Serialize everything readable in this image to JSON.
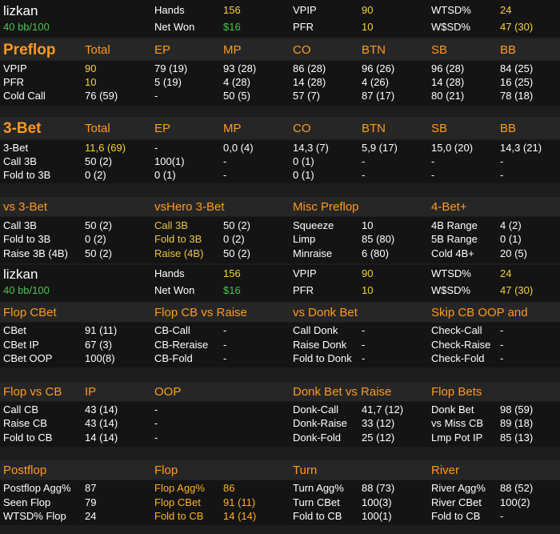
{
  "colors": {
    "orange": "#ff9a1f",
    "green": "#4cc24c",
    "yellow": "#f5d33b",
    "white": "#ffffff",
    "background": "#1d1d1d"
  },
  "player": {
    "name": "lizkan",
    "stack": "40 bb/100",
    "hands_label": "Hands",
    "hands": "156",
    "netwon_label": "Net Won",
    "netwon": "$16",
    "vpip_label": "VPIP",
    "vpip": "90",
    "pfr_label": "PFR",
    "pfr": "10",
    "wtsd_label": "WTSD%",
    "wtsd": "24",
    "wsd_label": "W$SD%",
    "wsd": "47 (30)"
  },
  "preflop": {
    "title": "Preflop",
    "columns": [
      "Total",
      "EP",
      "MP",
      "CO",
      "BTN",
      "SB",
      "BB"
    ],
    "rows": [
      {
        "label": "VPIP",
        "values": [
          "90",
          "79 (19)",
          "93 (28)",
          "86 (28)",
          "96 (26)",
          "96 (28)",
          "84 (25)"
        ]
      },
      {
        "label": "PFR",
        "values": [
          "10",
          "5 (19)",
          "4 (28)",
          "14 (28)",
          "4 (26)",
          "14 (28)",
          "16 (25)"
        ]
      },
      {
        "label": "Cold Call",
        "values": [
          "76 (59)",
          "-",
          "50 (5)",
          "57 (7)",
          "87 (17)",
          "80 (21)",
          "78 (18)"
        ]
      }
    ]
  },
  "threebet": {
    "title": "3-Bet",
    "columns": [
      "Total",
      "EP",
      "MP",
      "CO",
      "BTN",
      "SB",
      "BB"
    ],
    "rows": [
      {
        "label": "3-Bet",
        "values": [
          "11,6 (69)",
          "-",
          "0,0 (4)",
          "14,3 (7)",
          "5,9 (17)",
          "15,0 (20)",
          "14,3 (21)"
        ]
      },
      {
        "label": "Call 3B",
        "values": [
          "50 (2)",
          "100(1)",
          "-",
          "0 (1)",
          "-",
          "-",
          "-"
        ]
      },
      {
        "label": "Fold to 3B",
        "values": [
          "0 (2)",
          "0 (1)",
          "-",
          "0 (1)",
          "-",
          "-",
          "-"
        ]
      }
    ]
  },
  "vs3bet": {
    "title": "vs 3-Bet",
    "rows": [
      {
        "label": "Call 3B",
        "value": "50 (2)"
      },
      {
        "label": "Fold to 3B",
        "value": "0 (2)"
      },
      {
        "label": "Raise 3B (4B)",
        "value": "50 (2)"
      }
    ]
  },
  "vshero": {
    "title": "vsHero 3-Bet",
    "rows": [
      {
        "label": "Call 3B",
        "value": "50 (2)"
      },
      {
        "label": "Fold to 3B",
        "value": "0 (2)"
      },
      {
        "label": "Raise (4B)",
        "value": "50 (2)"
      }
    ]
  },
  "miscpre": {
    "title": "Misc Preflop",
    "rows": [
      {
        "label": "Squeeze",
        "value": "10"
      },
      {
        "label": "Limp",
        "value": "85 (80)"
      },
      {
        "label": "Minraise",
        "value": "6 (80)"
      }
    ]
  },
  "fourbet": {
    "title": "4-Bet+",
    "rows": [
      {
        "label": "4B Range",
        "value": "4 (2)"
      },
      {
        "label": "5B Range",
        "value": "0 (1)"
      },
      {
        "label": "Cold 4B+",
        "value": "20 (5)"
      }
    ]
  },
  "flopcbet": {
    "title": "Flop CBet",
    "rows": [
      {
        "label": "CBet",
        "value": "91 (11)"
      },
      {
        "label": "CBet IP",
        "value": "67 (3)"
      },
      {
        "label": "CBet OOP",
        "value": "100(8)"
      }
    ]
  },
  "flopcbvsraise": {
    "title": "Flop CB vs Raise",
    "rows": [
      {
        "label": "CB-Call",
        "value": "-"
      },
      {
        "label": "CB-Reraise",
        "value": "-"
      },
      {
        "label": "CB-Fold",
        "value": "-"
      }
    ]
  },
  "vsdonk": {
    "title": "vs Donk Bet",
    "rows": [
      {
        "label": "Call Donk",
        "value": "-"
      },
      {
        "label": "Raise Donk",
        "value": "-"
      },
      {
        "label": "Fold to Donk",
        "value": "-"
      }
    ]
  },
  "skipcb": {
    "title": "Skip CB OOP and",
    "rows": [
      {
        "label": "Check-Call",
        "value": "-"
      },
      {
        "label": "Check-Raise",
        "value": "-"
      },
      {
        "label": "Check-Fold",
        "value": "-"
      }
    ]
  },
  "flopvscb": {
    "title": "Flop vs CB",
    "col_ip": "IP",
    "col_oop": "OOP",
    "rows": [
      {
        "label": "Call CB",
        "ip": "43 (14)",
        "oop": "-"
      },
      {
        "label": "Raise CB",
        "ip": "43 (14)",
        "oop": "-"
      },
      {
        "label": "Fold to CB",
        "ip": "14 (14)",
        "oop": "-"
      }
    ]
  },
  "donkvsraise": {
    "title": "Donk Bet vs Raise",
    "rows": [
      {
        "label": "Donk-Call",
        "value": "41,7 (12)"
      },
      {
        "label": "Donk-Raise",
        "value": "33 (12)"
      },
      {
        "label": "Donk-Fold",
        "value": "25 (12)"
      }
    ]
  },
  "flopbets": {
    "title": "Flop Bets",
    "rows": [
      {
        "label": "Donk Bet",
        "value": "98 (59)"
      },
      {
        "label": "vs Miss CB",
        "value": "89 (18)"
      },
      {
        "label": "Lmp Pot IP",
        "value": "85 (13)"
      }
    ]
  },
  "postflop": {
    "title": "Postflop",
    "rows": [
      {
        "label": "Postflop Agg%",
        "value": "87"
      },
      {
        "label": "Seen Flop",
        "value": "79"
      },
      {
        "label": "WTSD% Flop",
        "value": "24"
      }
    ]
  },
  "flop": {
    "title": "Flop",
    "rows": [
      {
        "label": "Flop Agg%",
        "value": "86"
      },
      {
        "label": "Flop CBet",
        "value": "91 (11)"
      },
      {
        "label": "Fold to CB",
        "value": "14 (14)"
      }
    ]
  },
  "turn": {
    "title": "Turn",
    "rows": [
      {
        "label": "Turn Agg%",
        "value": "88 (73)"
      },
      {
        "label": "Turn CBet",
        "value": "100(3)"
      },
      {
        "label": "Fold to CB",
        "value": "100(1)"
      }
    ]
  },
  "river": {
    "title": "River",
    "rows": [
      {
        "label": "River Agg%",
        "value": "88 (52)"
      },
      {
        "label": "River CBet",
        "value": "100(2)"
      },
      {
        "label": "Fold to CB",
        "value": "-"
      }
    ]
  }
}
